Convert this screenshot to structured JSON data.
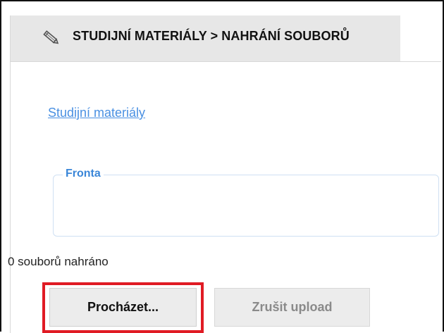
{
  "header": {
    "icon": "pencil-icon",
    "title": "STUDIJNÍ MATERIÁLY > NAHRÁNÍ SOUBORŮ"
  },
  "breadcrumb": {
    "link_label": "Studijní materiály"
  },
  "queue": {
    "legend": "Fronta"
  },
  "status": {
    "uploaded_text": "0 souborů nahráno"
  },
  "actions": {
    "browse_label": "Procházet...",
    "cancel_label": "Zrušit upload"
  },
  "colors": {
    "link": "#4a90e2",
    "legend": "#3a86d8",
    "highlight": "#e01b24",
    "header_bg": "#e7e7e7"
  }
}
